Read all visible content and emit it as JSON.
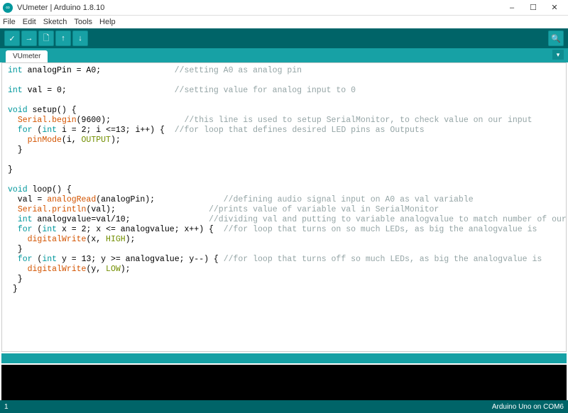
{
  "window": {
    "title": "VUmeter | Arduino 1.8.10",
    "min": "–",
    "max": "☐",
    "close": "✕"
  },
  "menu": {
    "file": "File",
    "edit": "Edit",
    "sketch": "Sketch",
    "tools": "Tools",
    "help": "Help"
  },
  "toolbar_icons": {
    "verify": "✓",
    "upload": "→",
    "new": "🗋",
    "open": "↑",
    "save": "↓",
    "monitor": "🔍"
  },
  "tab": {
    "name": "VUmeter",
    "menu": "▾"
  },
  "code": {
    "l1_a": "int",
    "l1_b": " analogPin = A0;               ",
    "l1_c": "//setting A0 as analog pin",
    "l3_a": "int",
    "l3_b": " val = 0;                      ",
    "l3_c": "//setting value for analog input to 0",
    "l5_a": "void",
    "l5_b": " setup() {",
    "l6_a": "  ",
    "l6_b": "Serial",
    "l6_c": ".begin",
    "l6_d": "(9600);               ",
    "l6_e": "//this line is used to setup SerialMonitor, to check value on our input",
    "l7_a": "  ",
    "l7_b": "for",
    "l7_c": " (",
    "l7_d": "int",
    "l7_e": " i = 2; i <=13; i++) {  ",
    "l7_f": "//for loop that defines desired LED pins as Outputs",
    "l8_a": "    ",
    "l8_b": "pinMode",
    "l8_c": "(i, ",
    "l8_d": "OUTPUT",
    "l8_e": ");",
    "l9": "  }",
    "l11": "}",
    "l13_a": "void",
    "l13_b": " loop() {",
    "l14_a": "  val = ",
    "l14_b": "analogRead",
    "l14_c": "(analogPin);              ",
    "l14_d": "//defining audio signal input on A0 as val variable",
    "l15_a": "  ",
    "l15_b": "Serial",
    "l15_c": ".println",
    "l15_d": "(val);                   ",
    "l15_e": "//prints value of variable val in SerialMonitor",
    "l16_a": "  ",
    "l16_b": "int",
    "l16_c": " analogvalue=val/10;                ",
    "l16_d": "//dividing val and putting to variable analogvalue to match number of our",
    "l17_a": "  ",
    "l17_b": "for",
    "l17_c": " (",
    "l17_d": "int",
    "l17_e": " x = 2; x <= analogvalue; x++) {  ",
    "l17_f": "//for loop that turns on so much LEDs, as big the analogvalue is",
    "l18_a": "    ",
    "l18_b": "digitalWrite",
    "l18_c": "(x, ",
    "l18_d": "HIGH",
    "l18_e": ");",
    "l19": "  }",
    "l20_a": "  ",
    "l20_b": "for",
    "l20_c": " (",
    "l20_d": "int",
    "l20_e": " y = 13; y >= analogvalue; y--) { ",
    "l20_f": "//for loop that turns off so much LEDs, as big the analogvalue is",
    "l21_a": "    ",
    "l21_b": "digitalWrite",
    "l21_c": "(y, ",
    "l21_d": "LOW",
    "l21_e": ");",
    "l22": "  }",
    "l23": " }"
  },
  "status": {
    "line": "1",
    "board": "Arduino Uno on COM6"
  }
}
